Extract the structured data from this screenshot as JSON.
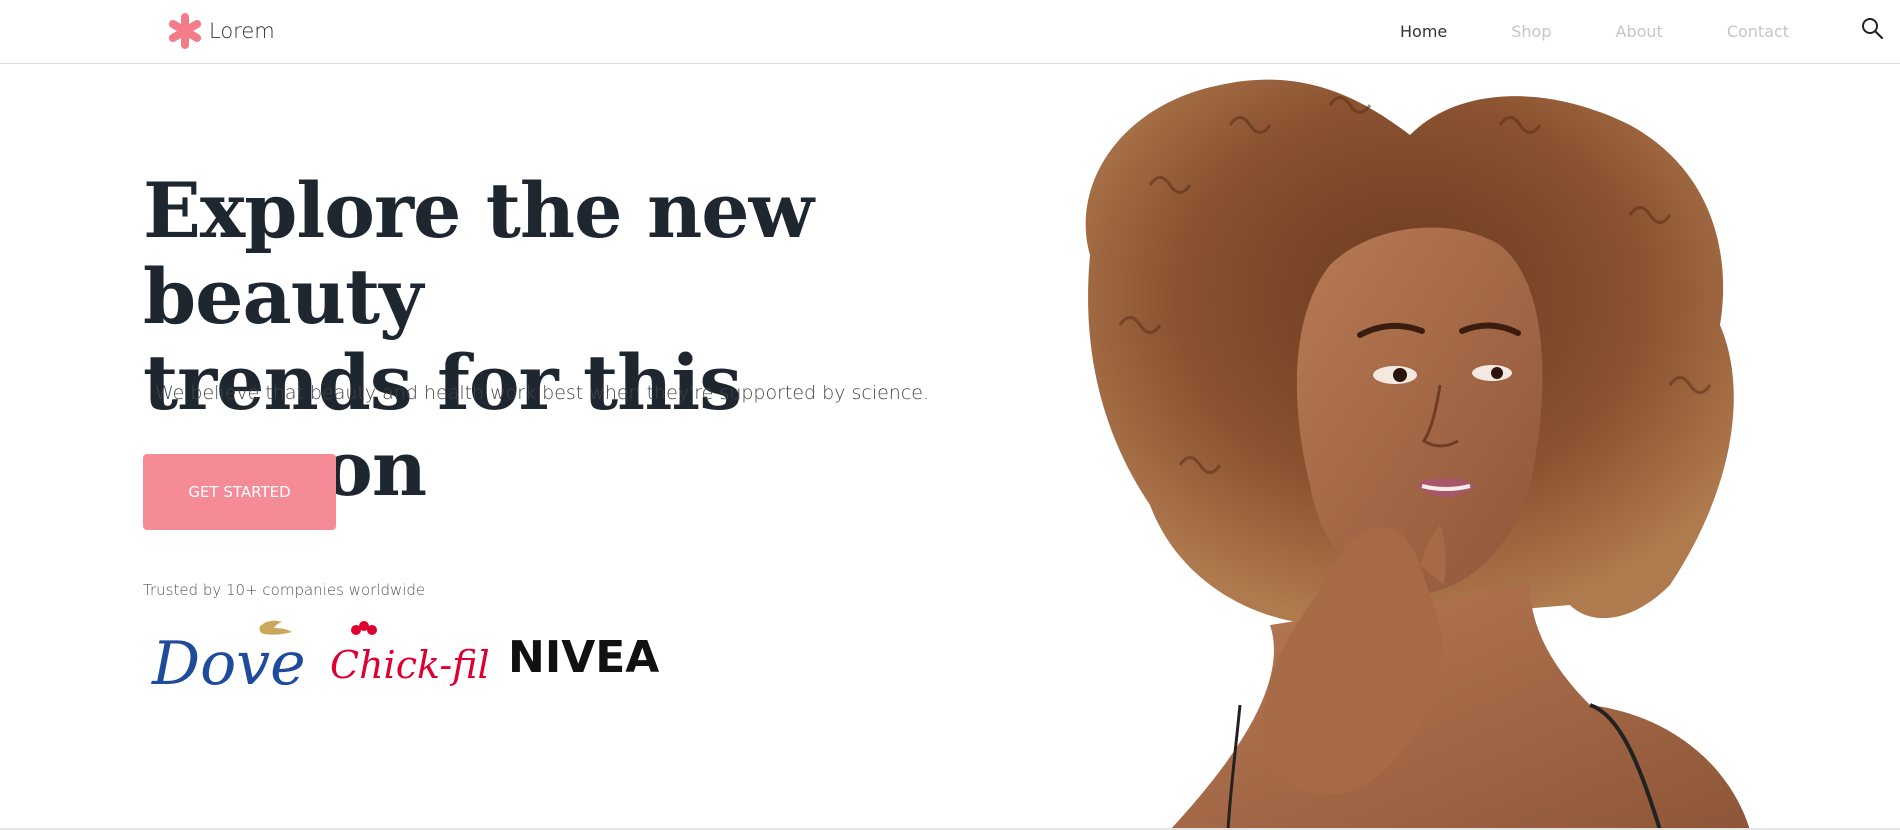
{
  "header": {
    "brand_name": "Lorem",
    "brand_color": "#f47c88",
    "nav": [
      {
        "label": "Home",
        "active": true
      },
      {
        "label": "Shop",
        "active": false
      },
      {
        "label": "About",
        "active": false
      },
      {
        "label": "Contact",
        "active": false
      }
    ],
    "search_icon": "search-icon"
  },
  "hero": {
    "title_line1": "Explore the new beauty",
    "title_line2": "trends for this season",
    "subtitle": "We believe that beauty and health work best when they're supported by science.",
    "cta_label": "GET STARTED",
    "cta_color": "#f48b97",
    "trusted_text": "Trusted by 10+ companies worldwide"
  },
  "logos": [
    {
      "name": "Dove",
      "color": "#1f4b9b"
    },
    {
      "name": "Chick-fil-A",
      "color": "#dd0031"
    },
    {
      "name": "NIVEA",
      "color": "#111111"
    }
  ]
}
